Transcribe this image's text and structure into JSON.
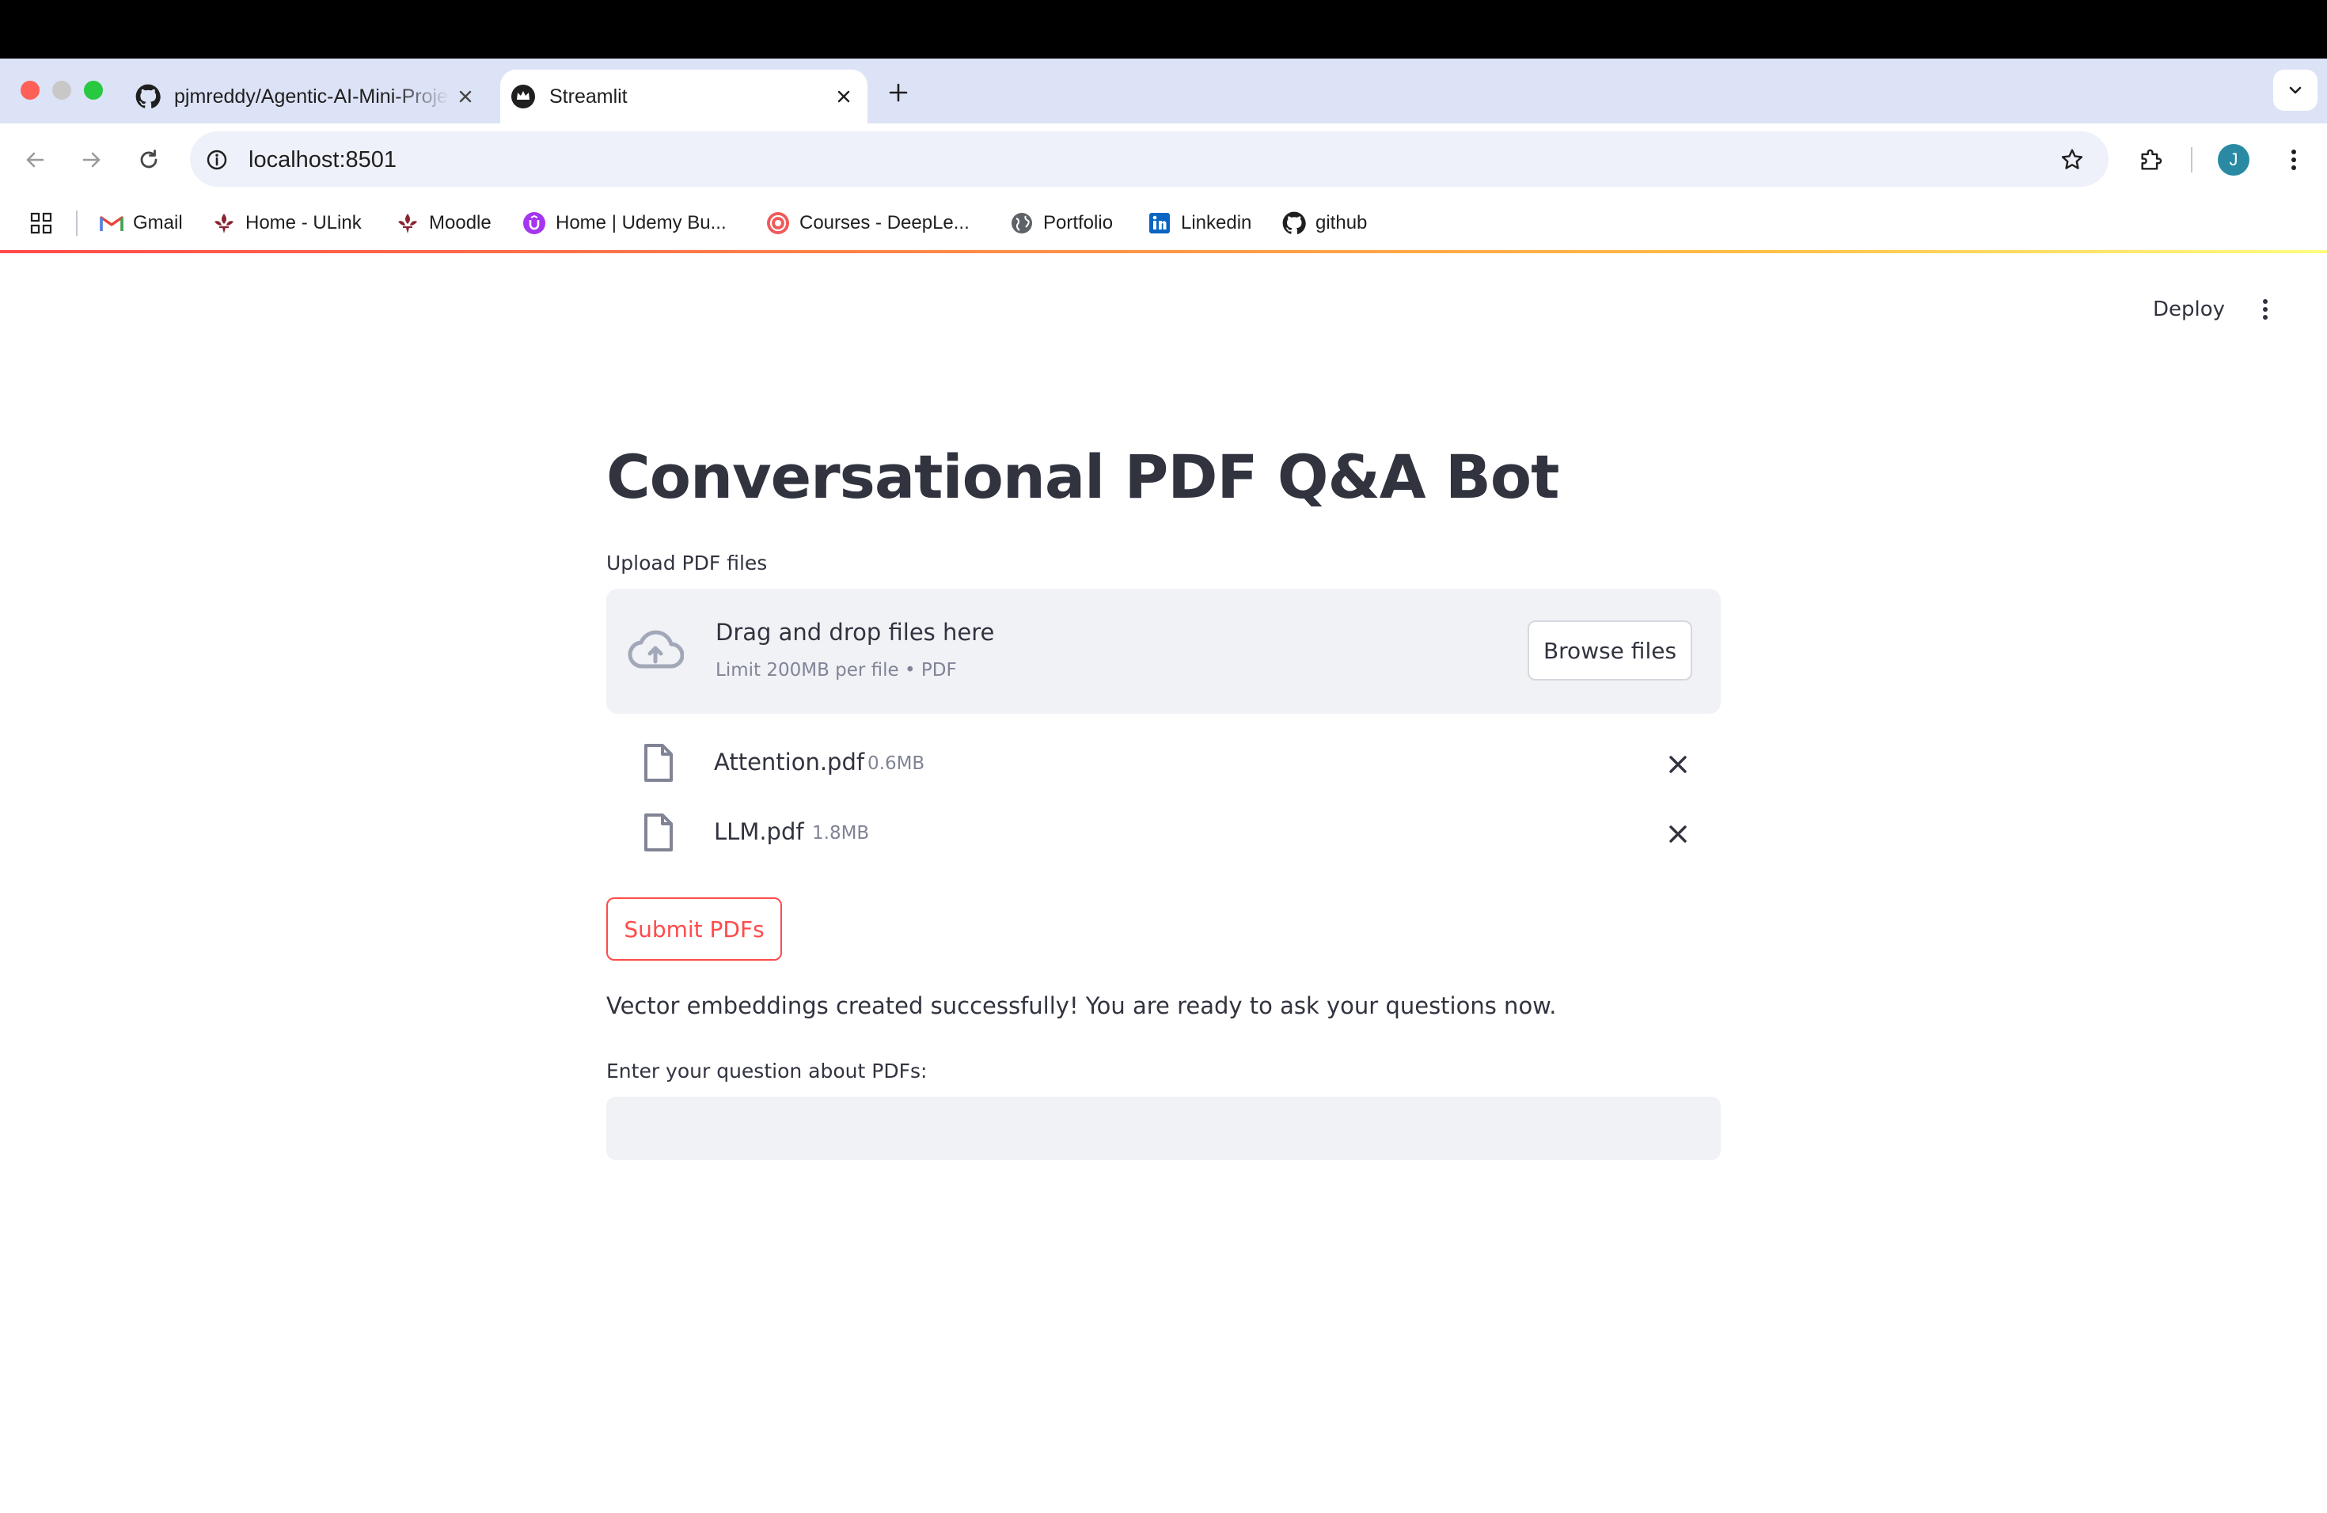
{
  "browser": {
    "tabs": [
      {
        "title": "pjmreddy/Agentic-AI-Mini-Projects",
        "active": false
      },
      {
        "title": "Streamlit",
        "active": true
      }
    ],
    "url": "localhost:8501",
    "profile_initial": "J",
    "bookmarks": [
      {
        "label": "Gmail",
        "icon": "gmail-icon"
      },
      {
        "label": "Home - ULink",
        "icon": "fleur-de-lis-icon"
      },
      {
        "label": "Moodle",
        "icon": "fleur-de-lis-icon"
      },
      {
        "label": "Home | Udemy Bu...",
        "icon": "udemy-icon"
      },
      {
        "label": "Courses - DeepLe...",
        "icon": "deeplearning-icon"
      },
      {
        "label": "Portfolio",
        "icon": "globe-icon"
      },
      {
        "label": "Linkedin",
        "icon": "linkedin-icon"
      },
      {
        "label": "github",
        "icon": "github-icon"
      }
    ]
  },
  "app": {
    "deploy_label": "Deploy",
    "title": "Conversational PDF Q&A Bot",
    "uploader": {
      "label": "Upload PDF files",
      "dropzone_text": "Drag and drop files here",
      "limit_text": "Limit 200MB per file • PDF",
      "browse_label": "Browse files"
    },
    "files": [
      {
        "name": "Attention.pdf",
        "size": "0.6MB"
      },
      {
        "name": "LLM.pdf",
        "size": "1.8MB"
      }
    ],
    "submit_label": "Submit PDFs",
    "status_message": "Vector embeddings created successfully! You are ready to ask your questions now.",
    "question_label": "Enter your question about PDFs:",
    "question_value": ""
  },
  "colors": {
    "accent": "#ff4b4b",
    "text": "#31333f",
    "muted": "#808495",
    "widget_bg": "#f0f2f6",
    "tabstrip": "#dde3f6"
  }
}
